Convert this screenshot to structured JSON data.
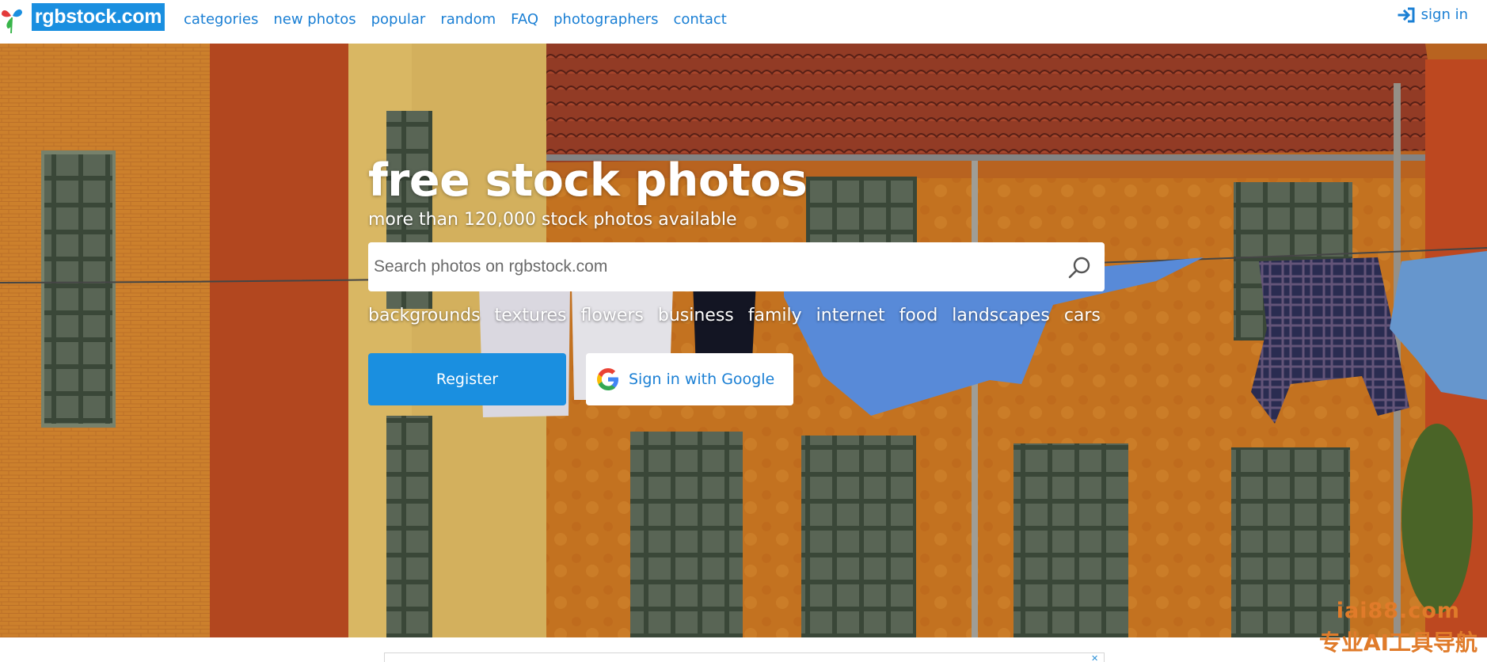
{
  "logo": {
    "text": "rgbstock.com"
  },
  "nav": {
    "items": [
      "categories",
      "new photos",
      "popular",
      "random",
      "FAQ",
      "photographers",
      "contact"
    ],
    "signin_label": "sign in"
  },
  "hero": {
    "title": "free stock photos",
    "subtitle": "more than 120,000 stock photos available",
    "search_placeholder": "Search photos on rgbstock.com",
    "tags": [
      "backgrounds",
      "textures",
      "flowers",
      "business",
      "family",
      "internet",
      "food",
      "landscapes",
      "cars"
    ],
    "register_label": "Register",
    "google_label": "Sign in with Google"
  },
  "watermark": {
    "line1": "iai88.com",
    "line2": "专业AI工具导航"
  },
  "colors": {
    "brand_blue": "#1a8fe0",
    "link_blue": "#1a7fd4",
    "watermark_orange": "#e07b2a"
  }
}
